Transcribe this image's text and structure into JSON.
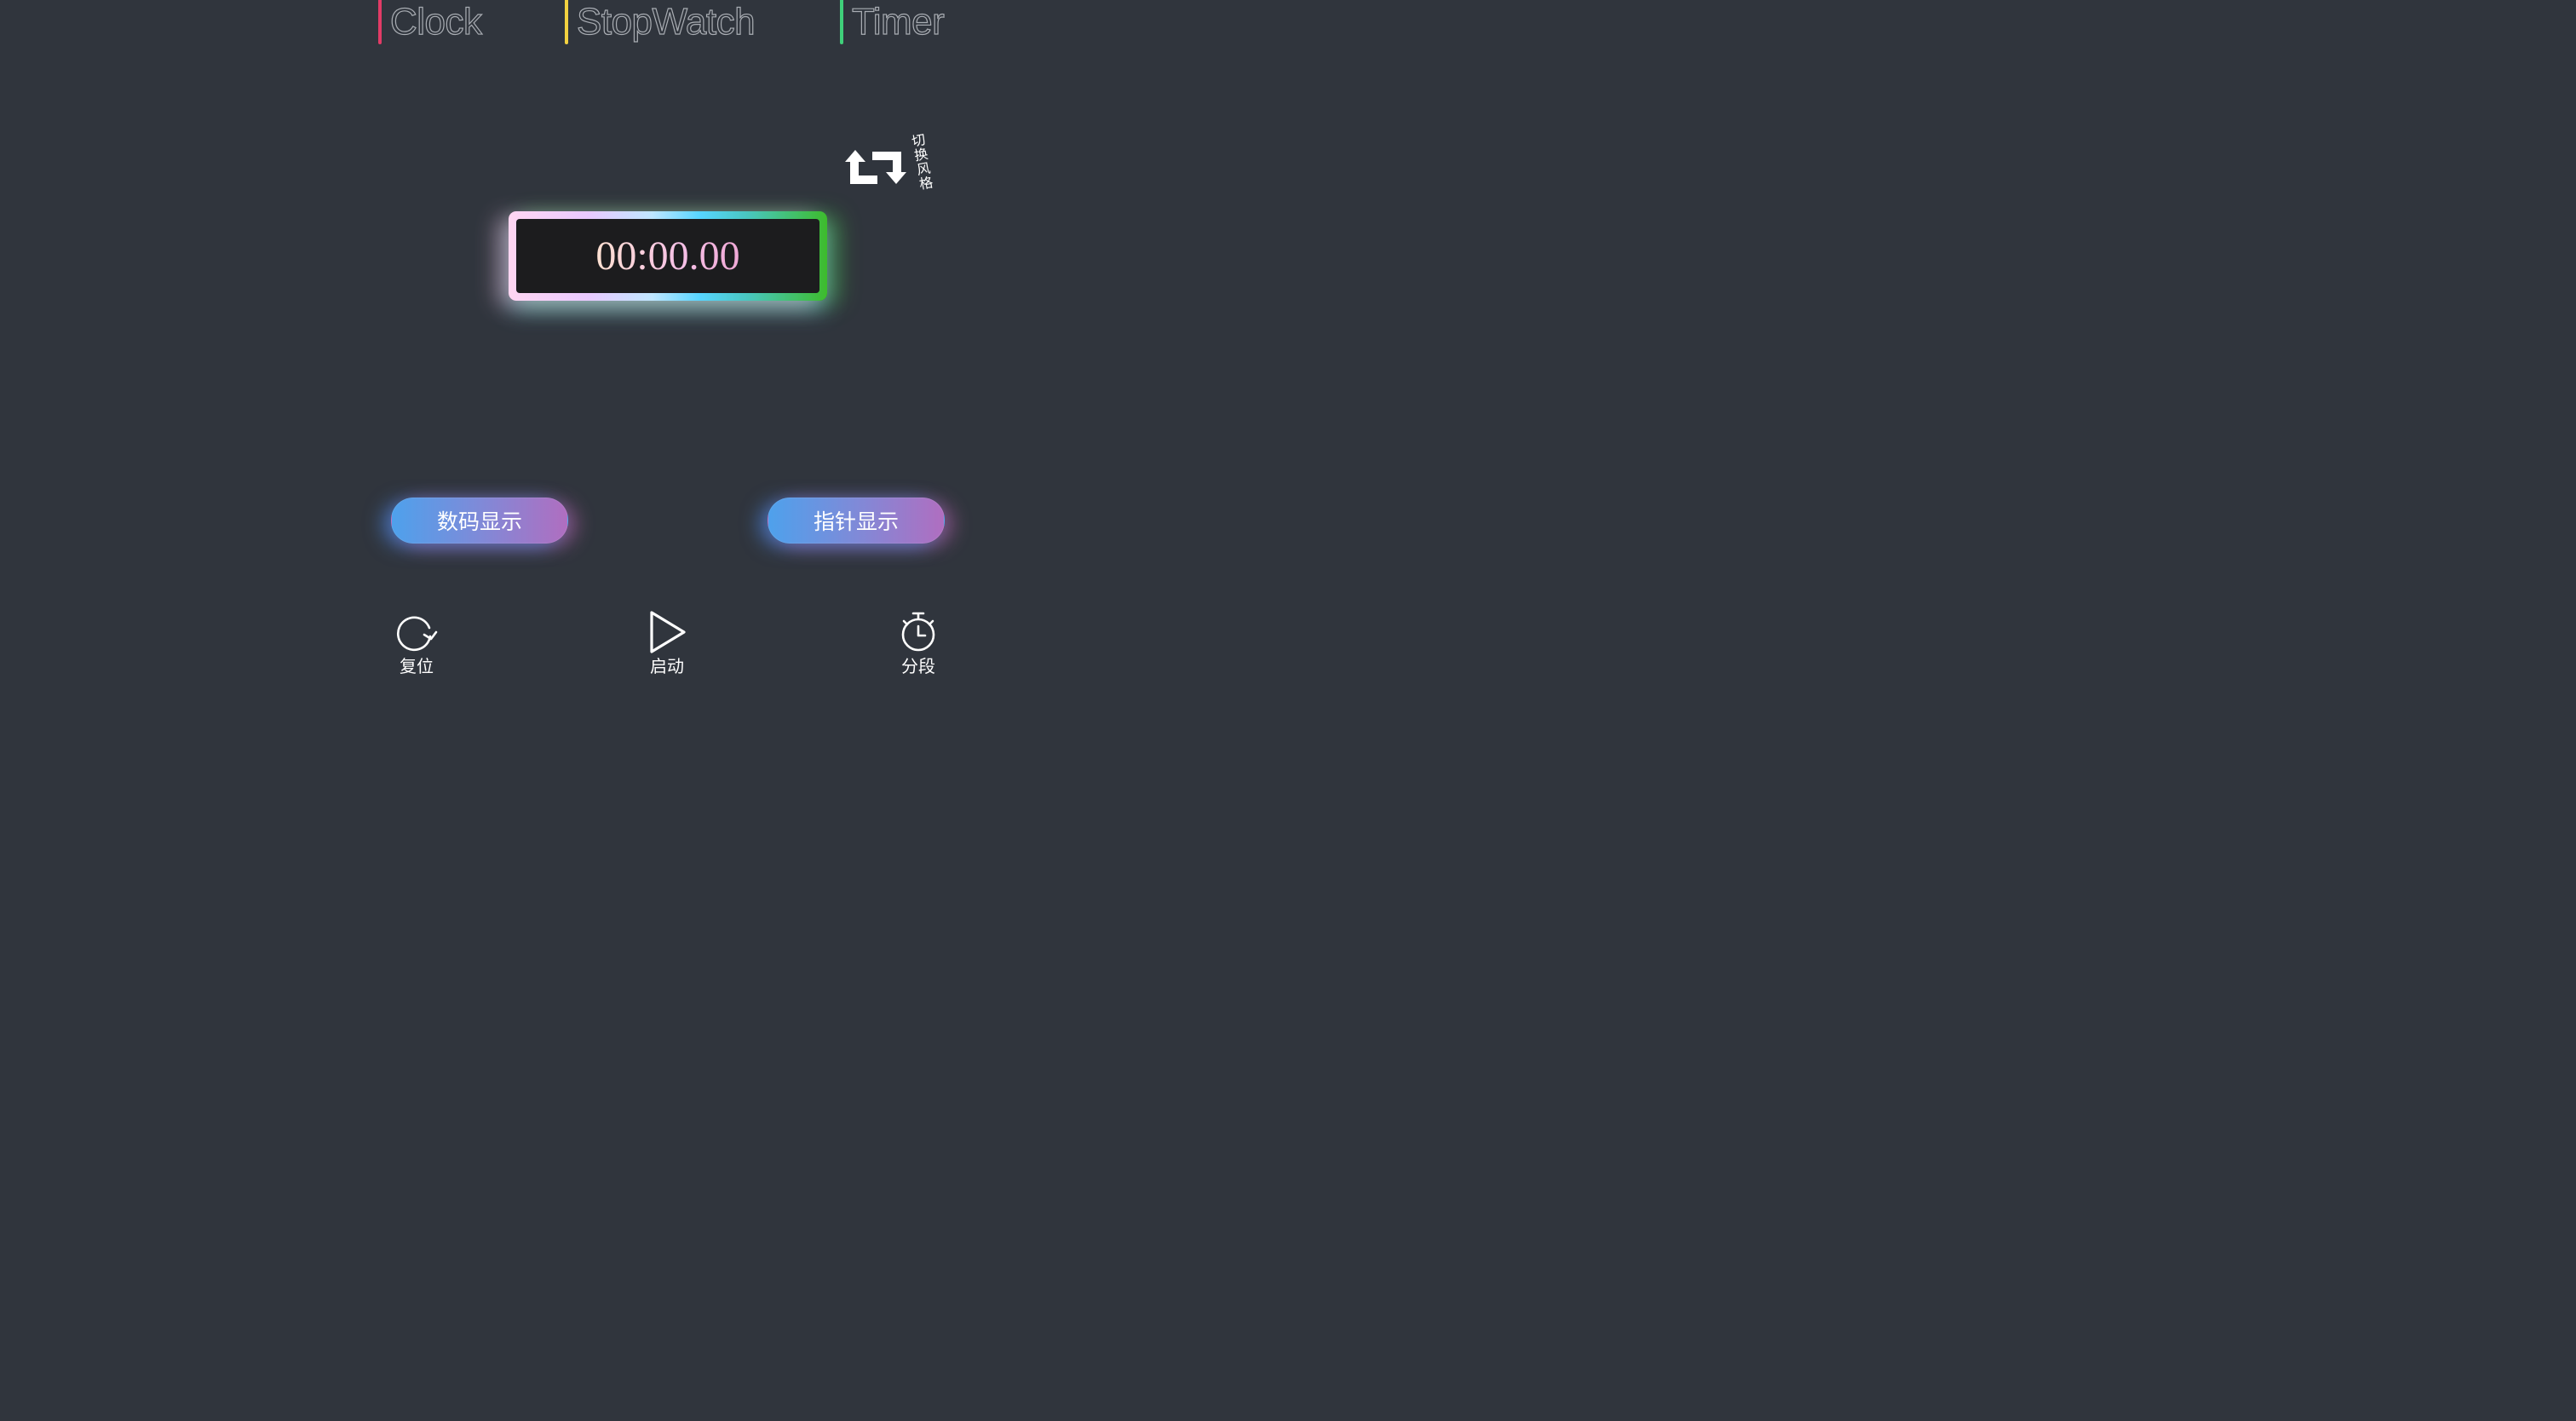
{
  "tabs": [
    {
      "label": "Clock",
      "color": "#e23b66"
    },
    {
      "label": "StopWatch",
      "color": "#f3d240"
    },
    {
      "label": "Timer",
      "color": "#3fd07a"
    }
  ],
  "switch_style": {
    "label": "切换风格",
    "icon": "repeat-icon"
  },
  "display": {
    "time": "00:00.00"
  },
  "mode_buttons": {
    "digital": "数码显示",
    "analog": "指针显示"
  },
  "controls": {
    "reset": {
      "label": "复位",
      "icon": "reset-icon"
    },
    "start": {
      "label": "启动",
      "icon": "play-icon"
    },
    "lap": {
      "label": "分段",
      "icon": "stopwatch-icon"
    }
  }
}
